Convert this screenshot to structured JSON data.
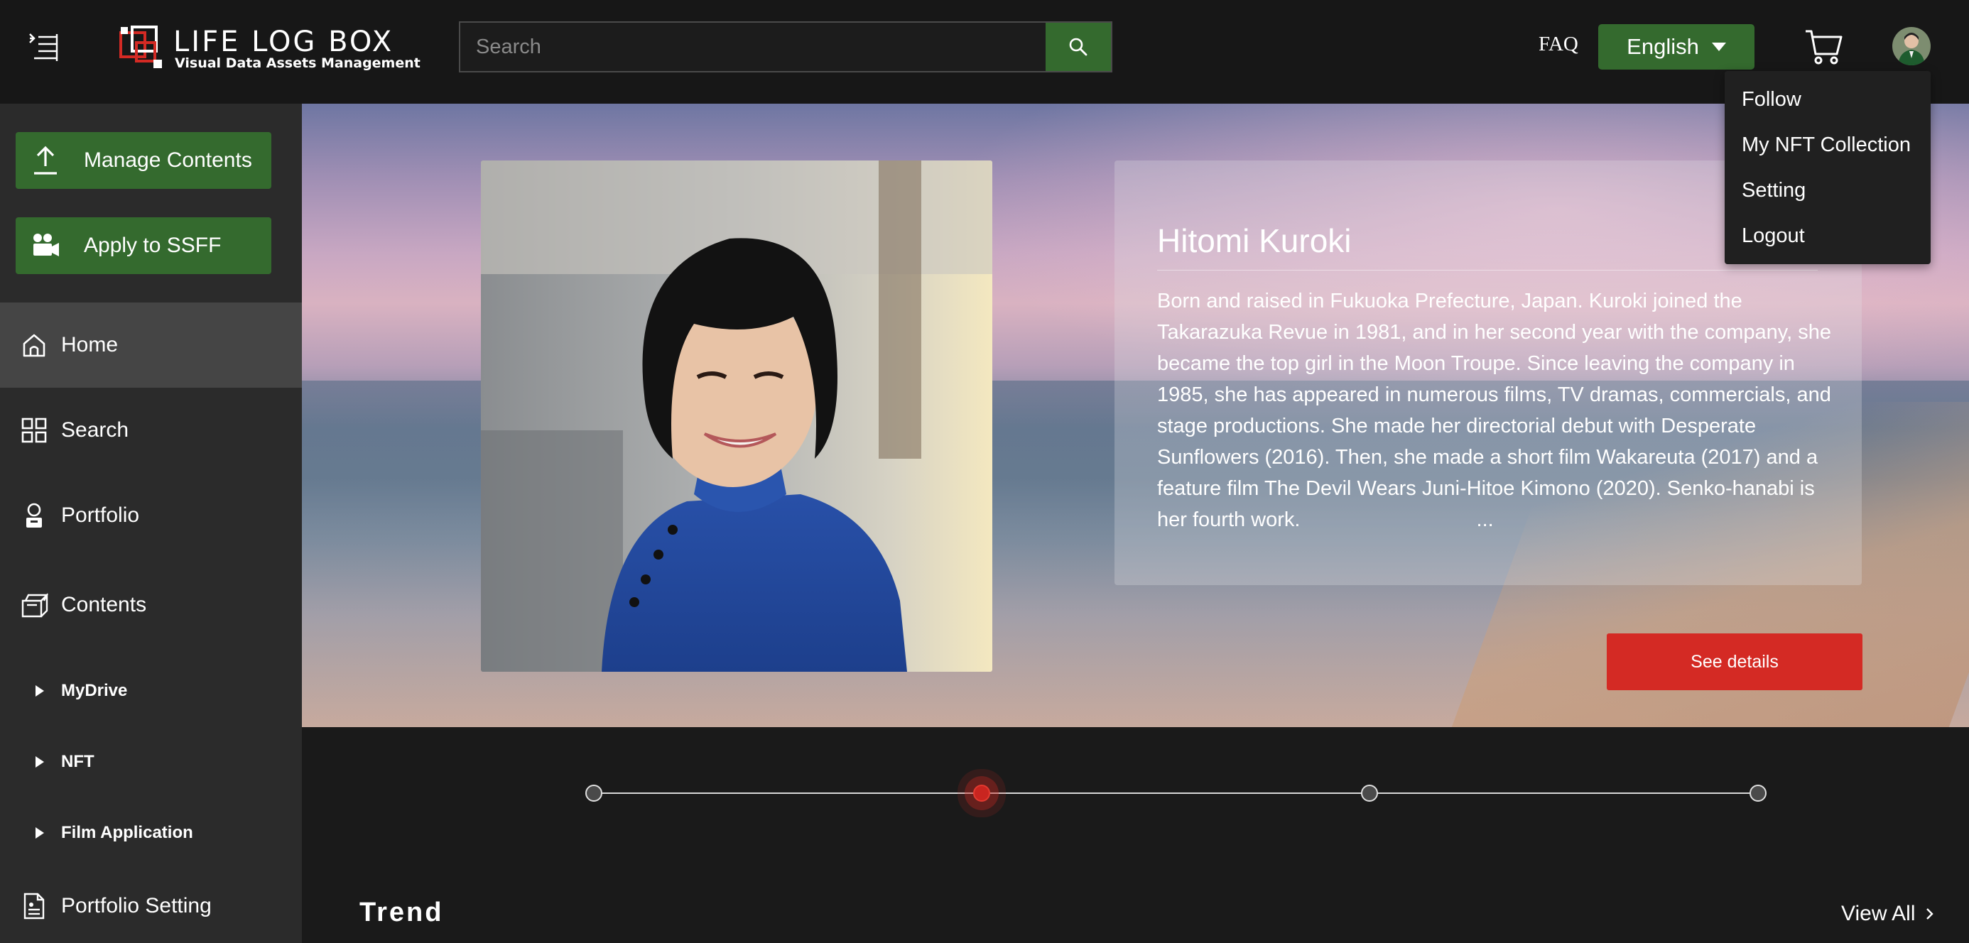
{
  "header": {
    "logo_title": "LIFE LOG BOX",
    "logo_subtitle": "Visual Data Assets Management",
    "search_placeholder": "Search",
    "faq_label": "FAQ",
    "language_label": "English"
  },
  "user_menu": {
    "items": [
      "Follow",
      "My NFT Collection",
      "Setting",
      "Logout"
    ]
  },
  "sidebar": {
    "actions": [
      {
        "label": "Manage Contents",
        "icon": "upload-icon"
      },
      {
        "label": "Apply to SSFF",
        "icon": "video-camera-icon"
      }
    ],
    "nav": [
      {
        "label": "Home",
        "icon": "home-icon",
        "active": true
      },
      {
        "label": "Search",
        "icon": "grid-icon"
      },
      {
        "label": "Portfolio",
        "icon": "portfolio-icon"
      },
      {
        "label": "Contents",
        "icon": "contents-icon"
      }
    ],
    "sub_nav": [
      {
        "label": "MyDrive"
      },
      {
        "label": "NFT"
      },
      {
        "label": "Film Application"
      }
    ],
    "portfolio_setting_label": "Portfolio Setting"
  },
  "hero": {
    "name": "Hitomi Kuroki",
    "bio": "Born and raised in Fukuoka Prefecture, Japan. Kuroki joined the Takarazuka Revue in 1981, and in her second year with the company, she became the top girl in the Moon Troupe. Since leaving the company in 1985, she has appeared in numerous films, TV dramas, commercials, and stage productions. She made her directorial debut with Desperate Sunflowers (2016). Then, she made a short film Wakareuta (2017) and a feature film The Devil Wears Juni-Hitoe Kimono (2020). Senko-hanabi is her fourth work.",
    "ellipsis": "...",
    "details_button": "See details"
  },
  "carousel": {
    "slide_count": 4,
    "active_index": 1
  },
  "trend": {
    "title": "Trend",
    "view_all_label": "View All"
  },
  "colors": {
    "accent_green": "#346a2e",
    "accent_red": "#d42a24",
    "header_bg": "#171717",
    "sidebar_bg": "#2b2b2b"
  }
}
